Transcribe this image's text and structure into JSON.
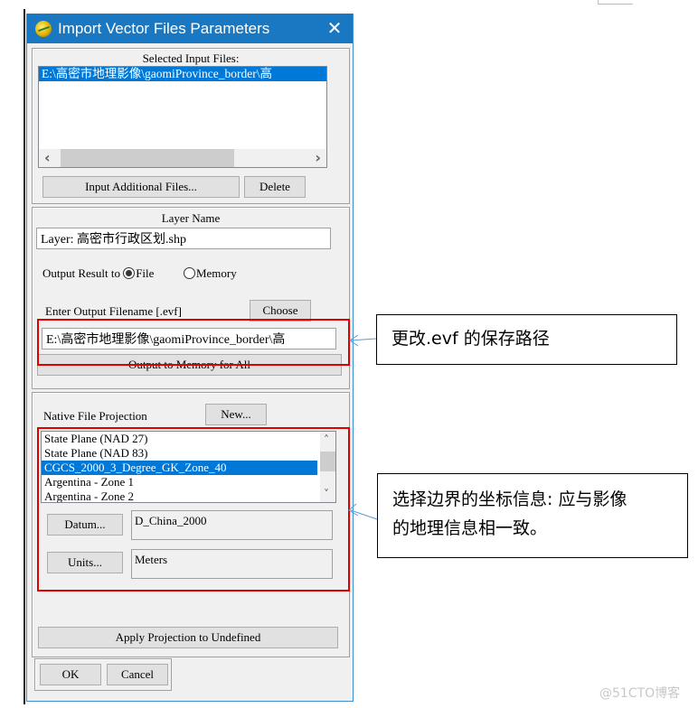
{
  "window": {
    "title": "Import Vector Files Parameters",
    "close_label": "✕"
  },
  "input_files": {
    "heading": "Selected Input Files:",
    "items": [
      "E:\\高密市地理影像\\gaomiProvince_border\\高"
    ],
    "selected_index": 0,
    "scroll_left_glyph": "‹",
    "scroll_right_glyph": "›",
    "add_button": "Input Additional Files...",
    "delete_button": "Delete"
  },
  "layer": {
    "heading": "Layer Name",
    "value": "Layer: 高密市行政区划.shp",
    "output_label": "Output Result to",
    "radio_file": "File",
    "radio_memory": "Memory",
    "selected_output": "File",
    "filename_label": "Enter Output Filename [.evf]",
    "choose_button": "Choose",
    "filename_value": "E:\\高密市地理影像\\gaomiProvince_border\\高",
    "memory_all_button": "Output to Memory for All"
  },
  "projection": {
    "label": "Native File Projection",
    "new_button": "New...",
    "items": [
      "State Plane (NAD 27)",
      "State Plane (NAD 83)",
      "CGCS_2000_3_Degree_GK_Zone_40",
      "Argentina - Zone 1",
      "Argentina - Zone 2"
    ],
    "selected_index": 2,
    "scroll_up_glyph": "˄",
    "scroll_down_glyph": "˅",
    "datum_button": "Datum...",
    "datum_value": "D_China_2000",
    "units_button": "Units...",
    "units_value": "Meters",
    "apply_button": "Apply Projection to Undefined"
  },
  "footer": {
    "ok_button": "OK",
    "cancel_button": "Cancel"
  },
  "annotations": {
    "callout_1": "更改.evf 的保存路径",
    "callout_2_line1": "选择边界的坐标信息: 应与影像",
    "callout_2_line2": "的地理信息相一致。",
    "highlight_color": "#e00000",
    "arrow_color": "#5b9bd5"
  },
  "watermark": "@51CTO博客",
  "colors": {
    "titlebar": "#1a78c2",
    "selection": "#0078d7",
    "dialog_bg": "#f0f0f0"
  }
}
